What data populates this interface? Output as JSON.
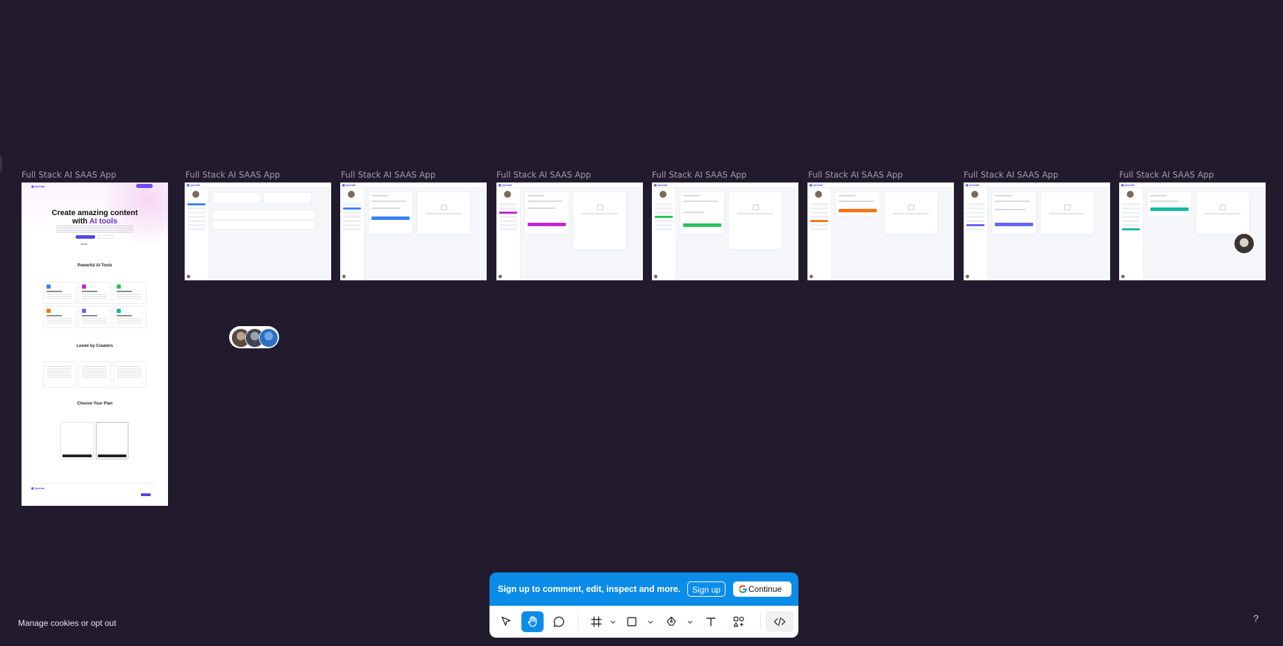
{
  "canvas": {
    "frames": [
      {
        "label": "Full Stack AI SAAS App"
      },
      {
        "label": "Full Stack AI SAAS App"
      },
      {
        "label": "Full Stack AI SAAS App"
      },
      {
        "label": "Full Stack AI SAAS App"
      },
      {
        "label": "Full Stack AI SAAS App"
      },
      {
        "label": "Full Stack AI SAAS App"
      },
      {
        "label": "Full Stack AI SAAS App"
      },
      {
        "label": "Full Stack AI SAAS App"
      }
    ],
    "landing": {
      "headline_line1": "Create amazing content",
      "headline_with": "with ",
      "headline_highlight": "AI tools",
      "features_title": "Powerful AI Tools",
      "testimonials_title": "Loved by Creators",
      "pricing_title": "Choose Your Plan"
    }
  },
  "banner": {
    "message": "Sign up to comment, edit, inspect and more.",
    "signup_label": "Sign up",
    "continue_label": "Continue"
  },
  "toolbar": {
    "tools": [
      "move-tool",
      "hand-tool",
      "comment-tool",
      "frame-tool",
      "shape-tool",
      "pen-tool",
      "text-tool",
      "resources-tool",
      "dev-mode-tool"
    ],
    "active_tool": "hand-tool",
    "accent": "#0c8ce9"
  },
  "footer": {
    "cookies_label": "Manage cookies or opt out",
    "help_label": "?"
  },
  "colors": {
    "canvas_bg": "#221b2e",
    "frame_label": "#a29cab",
    "accent_blue": "#3b82f6",
    "accent_purple": "#9333ea",
    "accent_green": "#22c55e",
    "accent_orange": "#f97316",
    "accent_indigo": "#6366f1",
    "accent_teal": "#14b8a6"
  }
}
